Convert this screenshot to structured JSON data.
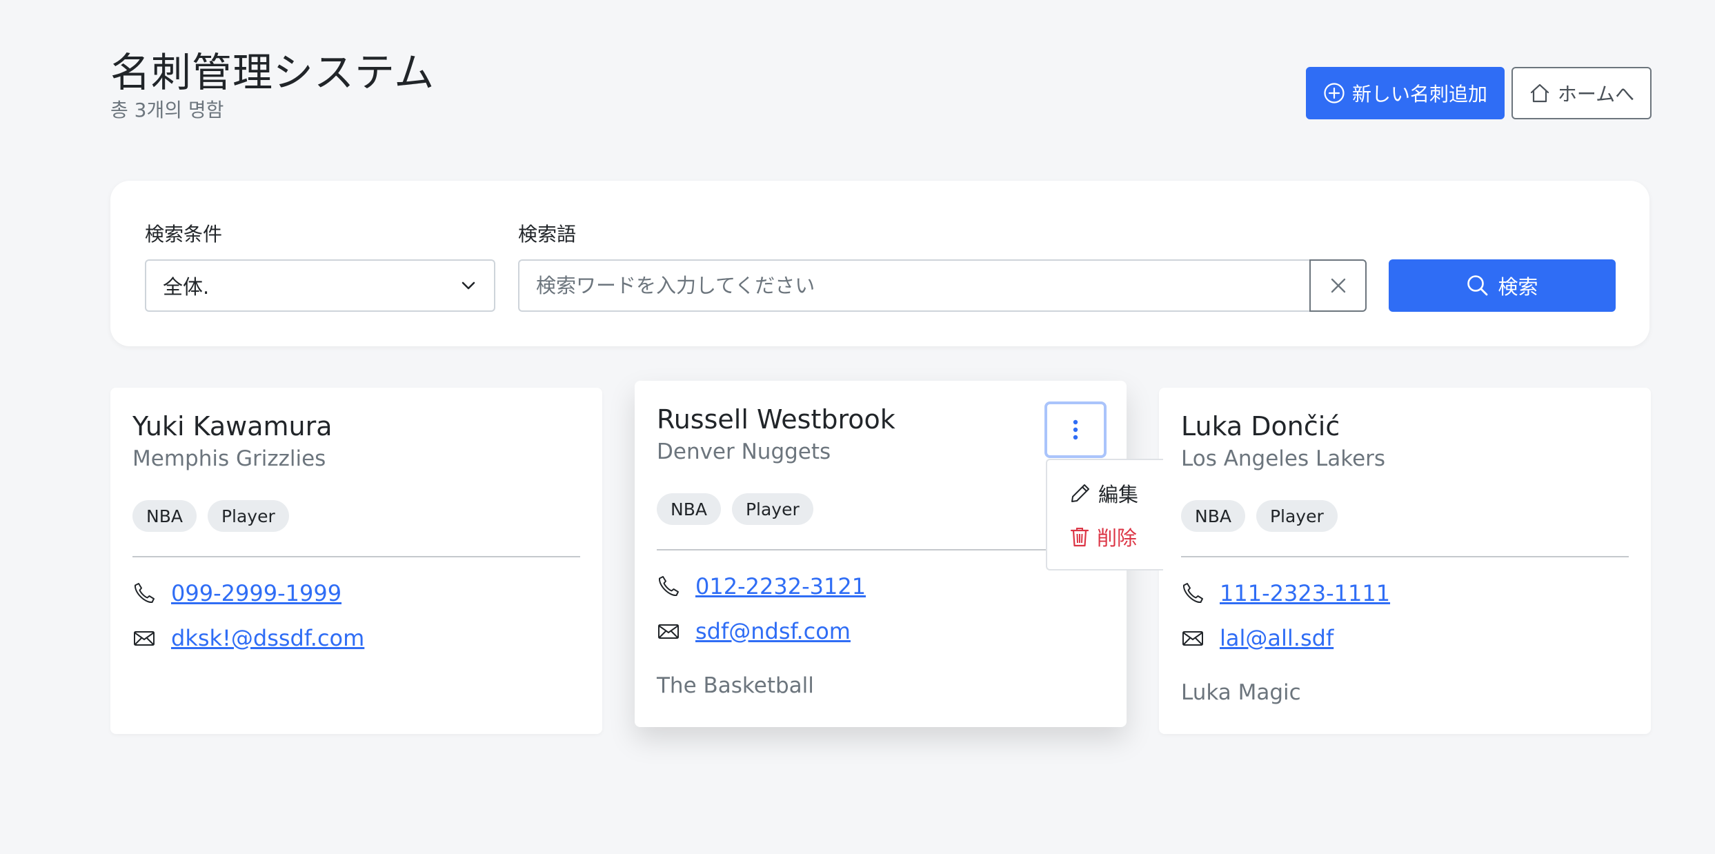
{
  "header": {
    "title": "名刺管理システム",
    "subtitle": "총 3개의 명함",
    "add_button_label": "新しい名刺追加",
    "home_button_label": "ホームへ"
  },
  "search": {
    "condition_label": "検索条件",
    "condition_value": "全体.",
    "term_label": "検索語",
    "placeholder": "検索ワードを入力してください",
    "search_button_label": "検索"
  },
  "cards": [
    {
      "name": "Yuki Kawamura",
      "team": "Memphis Grizzlies",
      "tags": [
        "NBA",
        "Player"
      ],
      "phone": "099-2999-1999",
      "email": "dksk!@dssdf.com",
      "memo": ""
    },
    {
      "name": "Russell Westbrook",
      "team": "Denver Nuggets",
      "tags": [
        "NBA",
        "Player"
      ],
      "phone": "012-2232-3121",
      "email": "sdf@ndsf.com",
      "memo": "The Basketball"
    },
    {
      "name": "Luka Dončić",
      "team": "Los Angeles Lakers",
      "tags": [
        "NBA",
        "Player"
      ],
      "phone": "111-2323-1111",
      "email": "lal@all.sdf",
      "memo": "Luka Magic"
    }
  ],
  "menu": {
    "edit_label": "編集",
    "delete_label": "削除"
  },
  "colors": {
    "primary": "#2f6df5",
    "danger": "#dc3545",
    "muted": "#6c757d",
    "background": "#f5f6f8"
  },
  "icons": {
    "add": "plus-circle-icon",
    "home": "house-icon",
    "select": "chevron-down-icon",
    "clear": "x-icon",
    "search": "magnifier-icon",
    "phone": "telephone-icon",
    "email": "envelope-icon",
    "menu": "three-dots-vertical-icon",
    "edit": "pencil-icon",
    "delete": "trash-icon"
  }
}
